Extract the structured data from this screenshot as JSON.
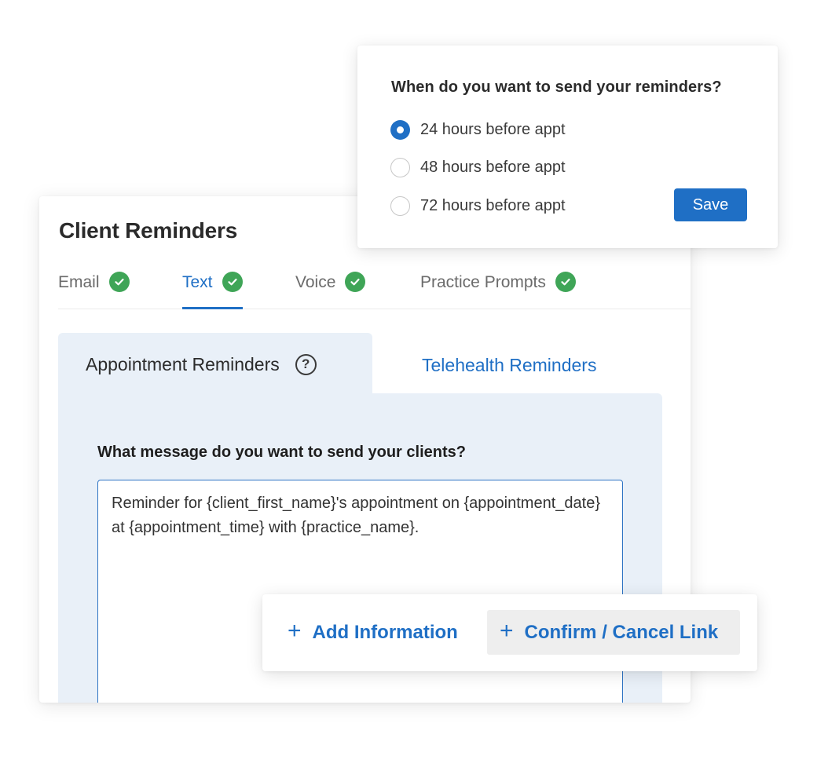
{
  "main": {
    "title": "Client Reminders",
    "channel_tabs": [
      {
        "label": "Email",
        "complete": true
      },
      {
        "label": "Text",
        "complete": true,
        "active": true
      },
      {
        "label": "Voice",
        "complete": true
      },
      {
        "label": "Practice Prompts",
        "complete": true
      }
    ],
    "sub_tabs": [
      {
        "label": "Appointment Reminders",
        "active": true
      },
      {
        "label": "Telehealth Reminders"
      }
    ],
    "help_icon": "?",
    "message_label": "What message do you want to send your clients?",
    "message_value": "Reminder for {client_first_name}'s appointment on {appointment_date} at {appointment_time} with {practice_name}."
  },
  "timing": {
    "question": "When do you want to send your reminders?",
    "options": [
      {
        "label": "24 hours before appt",
        "selected": true
      },
      {
        "label": "48 hours before appt",
        "selected": false
      },
      {
        "label": "72 hours before appt",
        "selected": false
      }
    ],
    "save_label": "Save"
  },
  "insert_toolbar": {
    "add_information": "Add Information",
    "confirm_cancel_link": "Confirm / Cancel Link",
    "plus_glyph": "+"
  },
  "colors": {
    "accent": "#1f6fc5",
    "success": "#3fa557",
    "panel_bg": "#e9f0f8"
  },
  "icons": [
    "check-circle-icon",
    "help-circle-icon",
    "plus-icon"
  ]
}
